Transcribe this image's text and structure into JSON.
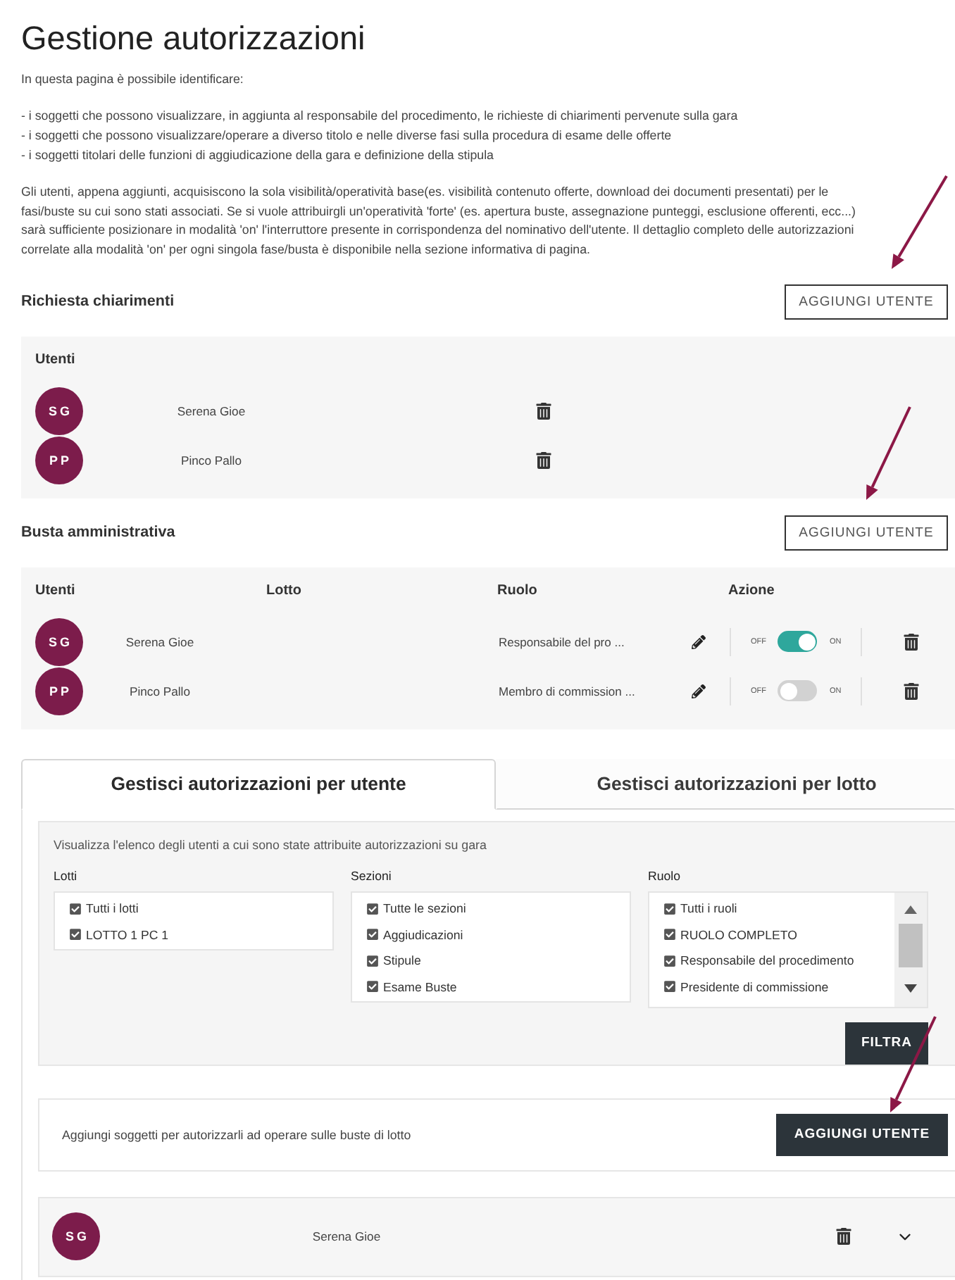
{
  "page": {
    "title": "Gestione autorizzazioni"
  },
  "intro": {
    "lead": "In questa pagina è possibile identificare:",
    "bullets": [
      "- i soggetti che possono visualizzare, in aggiunta al responsabile del procedimento, le richieste di chiarimenti pervenute sulla gara",
      "- i soggetti che possono visualizzare/operare a diverso titolo e nelle diverse fasi sulla procedura di esame delle offerte",
      "- i soggetti titolari delle funzioni di aggiudicazione della gara e definizione della stipula"
    ],
    "paragraph": "Gli utenti, appena aggiunti, acquisiscono la sola visibilità/operatività base(es. visibilità contenuto offerte, download dei documenti presentati) per le fasi/buste su cui sono stati associati. Se si vuole attribuirgli un'operatività 'forte' (es. apertura buste, assegnazione punteggi, esclusione offerenti, ecc...) sarà sufficiente posizionare in modalità 'on' l'interruttore presente in corrispondenza del nominativo dell'utente. Il dettaglio completo delle autorizzazioni correlate alla modalità 'on' per ogni singola fase/busta è disponibile nella sezione informativa di pagina."
  },
  "richiesta_chiarimenti": {
    "title": "Richiesta chiarimenti",
    "add_button": "AGGIUNGI UTENTE",
    "column_header": "Utenti",
    "users": [
      {
        "initials": "SG",
        "name": "Serena Gioe"
      },
      {
        "initials": "PP",
        "name": "Pinco Pallo"
      }
    ]
  },
  "busta_amministrativa": {
    "title": "Busta amministrativa",
    "add_button": "AGGIUNGI UTENTE",
    "columns": [
      "Utenti",
      "Lotto",
      "Ruolo",
      "Azione"
    ],
    "rows": [
      {
        "initials": "SG",
        "name": "Serena Gioe",
        "ruolo": "Responsabile del pro ...",
        "off_label": "OFF",
        "on_label": "ON",
        "on": true
      },
      {
        "initials": "PP",
        "name": "Pinco Pallo",
        "ruolo": "Membro di commission ...",
        "off_label": "OFF",
        "on_label": "ON",
        "on": false
      }
    ]
  },
  "tabs": [
    {
      "label": "Gestisci autorizzazioni per utente",
      "selected": true
    },
    {
      "label": "Gestisci autorizzazioni per lotto",
      "selected": false
    }
  ],
  "filter": {
    "description": "Visualizza l'elenco degli utenti a cui sono state attribuite autorizzazioni su gara",
    "groups": [
      {
        "label": "Lotti",
        "kind": "plain",
        "items": [
          {
            "label": "Tutti i lotti",
            "checked": true
          },
          {
            "label": "LOTTO 1 PC 1",
            "checked": true
          }
        ]
      },
      {
        "label": "Sezioni",
        "kind": "plain",
        "items": [
          {
            "label": "Tutte le sezioni",
            "checked": true
          },
          {
            "label": "Aggiudicazioni",
            "checked": true
          },
          {
            "label": "Stipule",
            "checked": true
          },
          {
            "label": "Esame Buste",
            "checked": true
          }
        ]
      },
      {
        "label": "Ruolo",
        "kind": "scroll",
        "items": [
          {
            "label": "Tutti i ruoli",
            "checked": true
          },
          {
            "label": "RUOLO COMPLETO",
            "checked": true
          },
          {
            "label": "Responsabile del procedimento",
            "checked": true
          },
          {
            "label": "Presidente di commissione",
            "checked": true
          }
        ]
      }
    ],
    "button": "FILTRA"
  },
  "add_panel": {
    "text": "Aggiungi soggetti per autorizzarli ad operare sulle buste di lotto",
    "button": "AGGIUNGI UTENTE"
  },
  "user_rows": [
    {
      "initials": "SG",
      "name": "Serena Gioe",
      "expanded": false
    }
  ]
}
